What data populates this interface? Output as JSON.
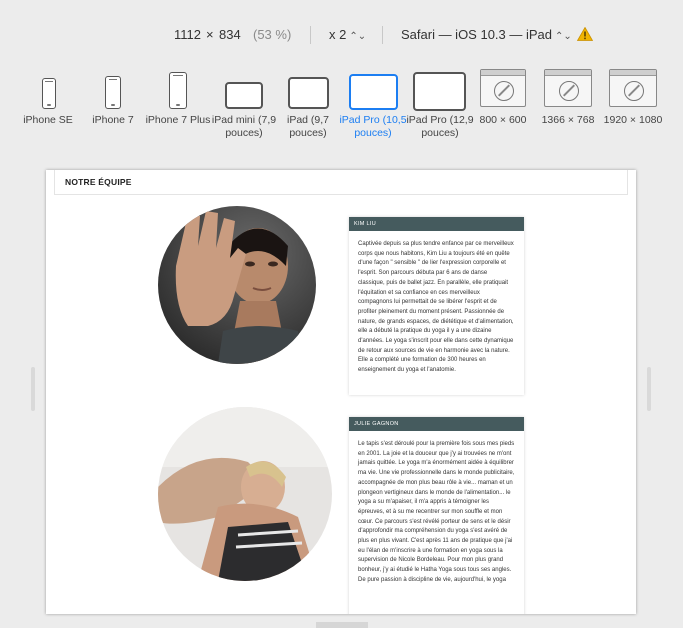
{
  "toolbar": {
    "width": "1112",
    "times": "×",
    "height": "834",
    "percent": "(53 %)",
    "scale": "x 2",
    "device_label": "Safari — iOS 10.3 — iPad",
    "warning_icon": "warning-icon",
    "warning_color": "#f0b400"
  },
  "devices": [
    {
      "label": "iPhone SE",
      "icon": "phone-icon"
    },
    {
      "label": "iPhone 7",
      "icon": "phone-icon"
    },
    {
      "label": "iPhone 7 Plus",
      "icon": "phone-icon"
    },
    {
      "label": "iPad mini (7,9 pouces)",
      "icon": "tablet-icon"
    },
    {
      "label": "iPad (9,7 pouces)",
      "icon": "tablet-icon"
    },
    {
      "label": "iPad Pro (10,5 pouces)",
      "icon": "tablet-icon",
      "selected": true
    },
    {
      "label": "iPad Pro (12,9 pouces)",
      "icon": "tablet-icon"
    },
    {
      "label": "800 × 600",
      "icon": "browser-compass-icon"
    },
    {
      "label": "1366 × 768",
      "icon": "browser-compass-icon"
    },
    {
      "label": "1920 × 1080",
      "icon": "browser-compass-icon"
    }
  ],
  "accent_color": "#1c7ef2",
  "page": {
    "section_title": "NOTRE ÉQUIPE",
    "members": [
      {
        "name": "KIM LIU",
        "bio": "Captivée depuis sa plus tendre enfance par ce merveilleux corps que nous habitons, Kim Liu a toujours été en quête d'une façon \" sensible \" de lier l'expression corporelle et l'esprit. Son parcours débuta par 6 ans de danse classique, puis de ballet jazz. En parallèle, elle pratiquait l'équitation et sa confiance en ces merveilleux compagnons lui permettait de se libérer l'esprit et de profiter pleinement du moment présent. Passionnée de nature, de grands espaces, de diététique et d'alimentation, elle a débuté la pratique du yoga il y a une dizaine d'années. Le yoga s'inscrit pour elle dans cette dynamique de retour aux sources de vie en harmonie avec la nature. Elle a complété une formation de 300 heures en enseignement du yoga et l'anatomie."
      },
      {
        "name": "JULIE GAGNON",
        "bio": "Le tapis s'est déroulé pour la première fois sous mes pieds en 2001. La joie et la douceur que j'y ai trouvées ne m'ont jamais quittée. Le yoga m'a énormément aidée à équilibrer ma vie. Une vie professionnelle dans le monde publicitaire, accompagnée de mon plus beau rôle à vie... maman et un plongeon vertigineux dans le monde de l'alimentation... le yoga a su m'apaiser, il m'a appris à témoigner les épreuves, et à su me recentrer sur mon souffle et mon cœur. Ce parcours s'est révélé porteur de sens et le désir d'approfondir ma compréhension du yoga s'est avéré de plus en plus vivant. C'est après 11 ans de pratique que j'ai eu l'élan de m'inscrire à une formation en yoga sous la supervision de Nicole Bordeleau. Pour mon plus grand bonheur, j'y ai étudié le Hatha Yoga sous tous ses angles. De pure passion à discipline de vie, aujourd'hui, le yoga"
      }
    ],
    "card_header_color": "#455b5e"
  }
}
